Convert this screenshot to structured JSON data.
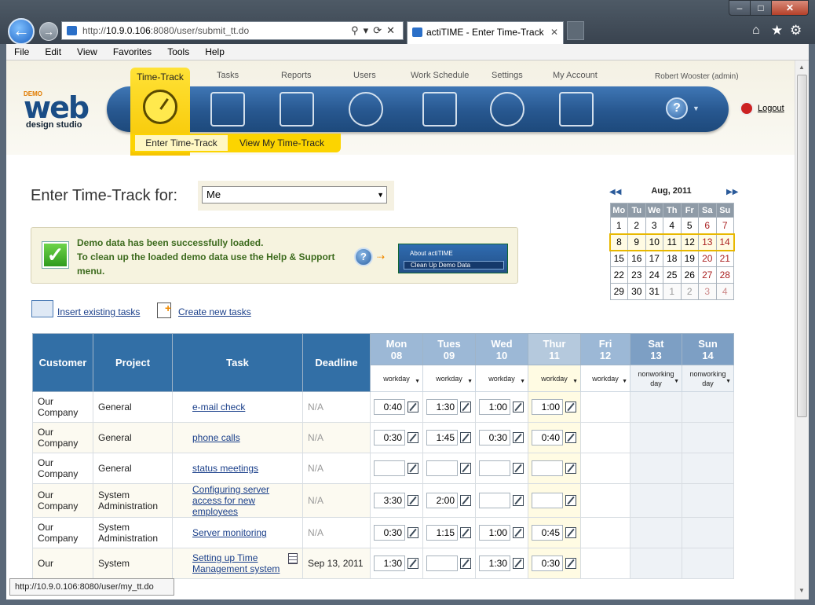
{
  "browser": {
    "url_prefix": "http://",
    "url_host": "10.9.0.106",
    "url_rest": ":8080/user/submit_tt.do",
    "tab_title": "actiTIME - Enter Time-Track",
    "status_url": "http://10.9.0.106:8080/user/my_tt.do",
    "menu": [
      "File",
      "Edit",
      "View",
      "Favorites",
      "Tools",
      "Help"
    ]
  },
  "header": {
    "logo_demo": "DEMO",
    "logo_text": "web",
    "logo_sub": "design studio",
    "nav": [
      {
        "label": "Time-Track",
        "icon": "clock-icon"
      },
      {
        "label": "Tasks",
        "icon": "tasks-icon"
      },
      {
        "label": "Reports",
        "icon": "reports-icon"
      },
      {
        "label": "Users",
        "icon": "users-icon"
      },
      {
        "label": "Work Schedule",
        "icon": "calendar-icon"
      },
      {
        "label": "Settings",
        "icon": "gear-icon"
      },
      {
        "label": "My Account",
        "icon": "account-icon"
      }
    ],
    "sub_enter": "Enter Time-Track",
    "sub_view": "View My Time-Track",
    "user": "Robert Wooster (admin)",
    "logout": "Logout"
  },
  "form": {
    "label": "Enter Time-Track for:",
    "user_value": "Me"
  },
  "notice": {
    "line1": "Demo data has been successfully loaded.",
    "line2": "To clean up the loaded demo data use the Help & Support menu.",
    "menu_item1": "About actiTIME",
    "menu_item2": "Clean Up Demo Data"
  },
  "links": {
    "insert": "Insert existing tasks",
    "create": "Create new tasks"
  },
  "calendar": {
    "title": "Aug, 2011",
    "days": [
      "Mo",
      "Tu",
      "We",
      "Th",
      "Fr",
      "Sa",
      "Su"
    ],
    "weeks": [
      [
        "1",
        "2",
        "3",
        "4",
        "5",
        "6",
        "7"
      ],
      [
        "8",
        "9",
        "10",
        "11",
        "12",
        "13",
        "14"
      ],
      [
        "15",
        "16",
        "17",
        "18",
        "19",
        "20",
        "21"
      ],
      [
        "22",
        "23",
        "24",
        "25",
        "26",
        "27",
        "28"
      ],
      [
        "29",
        "30",
        "31",
        "1",
        "2",
        "3",
        "4"
      ]
    ]
  },
  "grid": {
    "headers": {
      "customer": "Customer",
      "project": "Project",
      "task": "Task",
      "deadline": "Deadline"
    },
    "days": [
      {
        "name": "Mon",
        "num": "08",
        "type": "workday"
      },
      {
        "name": "Tues",
        "num": "09",
        "type": "workday"
      },
      {
        "name": "Wed",
        "num": "10",
        "type": "workday"
      },
      {
        "name": "Thur",
        "num": "11",
        "type": "workday"
      },
      {
        "name": "Fri",
        "num": "12",
        "type": "workday"
      },
      {
        "name": "Sat",
        "num": "13",
        "type": "nonworking day"
      },
      {
        "name": "Sun",
        "num": "14",
        "type": "nonworking day"
      }
    ],
    "rows": [
      {
        "customer": "Our Company",
        "project": "General",
        "task": "e-mail check",
        "deadline": "N/A",
        "times": [
          "0:40",
          "1:30",
          "1:00",
          "1:00"
        ]
      },
      {
        "customer": "Our Company",
        "project": "General",
        "task": "phone calls",
        "deadline": "N/A",
        "times": [
          "0:30",
          "1:45",
          "0:30",
          "0:40"
        ]
      },
      {
        "customer": "Our Company",
        "project": "General",
        "task": "status meetings",
        "deadline": "N/A",
        "times": [
          "",
          "",
          "",
          ""
        ]
      },
      {
        "customer": "Our Company",
        "project": "System Administration",
        "task": "Configuring server access for new employees",
        "deadline": "N/A",
        "times": [
          "3:30",
          "2:00",
          "",
          ""
        ]
      },
      {
        "customer": "Our Company",
        "project": "System Administration",
        "task": "Server monitoring",
        "deadline": "N/A",
        "times": [
          "0:30",
          "1:15",
          "1:00",
          "0:45"
        ]
      },
      {
        "customer": "Our",
        "project": "System",
        "task": "Setting up Time Management system",
        "deadline": "Sep 13, 2011",
        "times": [
          "1:30",
          "",
          "1:30",
          "0:30"
        ]
      }
    ]
  },
  "colors": {
    "nav_blue": "#27578f",
    "tab_yellow": "#fcd400",
    "header_blue": "#326fa6"
  }
}
